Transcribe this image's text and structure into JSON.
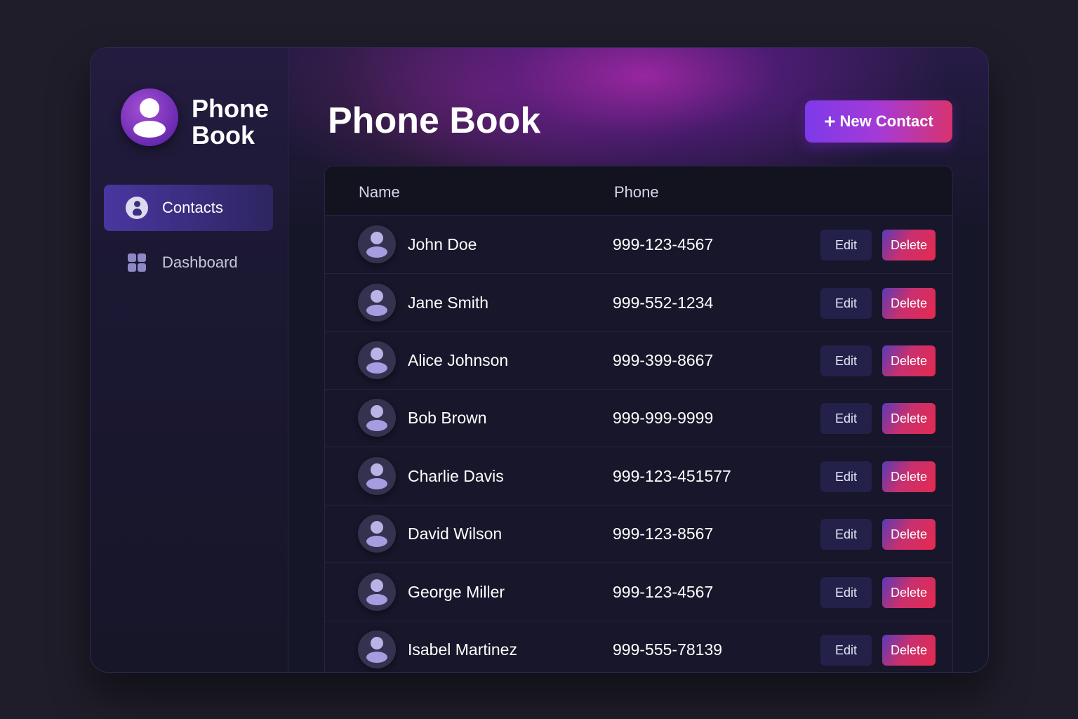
{
  "sidebar": {
    "brand": "Phone Book",
    "items": [
      {
        "label": "Contacts",
        "icon": "contact-icon",
        "active": true
      },
      {
        "label": "Dashboard",
        "icon": "grid-icon",
        "active": false
      }
    ]
  },
  "header": {
    "title": "Phone Book",
    "new_button": "New Contact",
    "new_button_icon": "+"
  },
  "table": {
    "columns": [
      "Name",
      "Phone"
    ],
    "edit_label": "Edit",
    "delete_label": "Delete",
    "rows": [
      {
        "name": "John Doe",
        "phone": "999-123-4567"
      },
      {
        "name": "Jane Smith",
        "phone": "999-552-1234"
      },
      {
        "name": "Alice Johnson",
        "phone": "999-399-8667"
      },
      {
        "name": "Bob Brown",
        "phone": "999-999-9999"
      },
      {
        "name": "Charlie Davis",
        "phone": "999-123-451577"
      },
      {
        "name": "David Wilson",
        "phone": "999-123-8567"
      },
      {
        "name": "George Miller",
        "phone": "999-123-4567"
      },
      {
        "name": "Isabel Martinez",
        "phone": "999-555-78139"
      }
    ]
  },
  "colors": {
    "background": "#1e1d29",
    "accent_purple": "#7c3aea",
    "accent_pink": "#d8336f",
    "delete_red": "#e52a50"
  }
}
